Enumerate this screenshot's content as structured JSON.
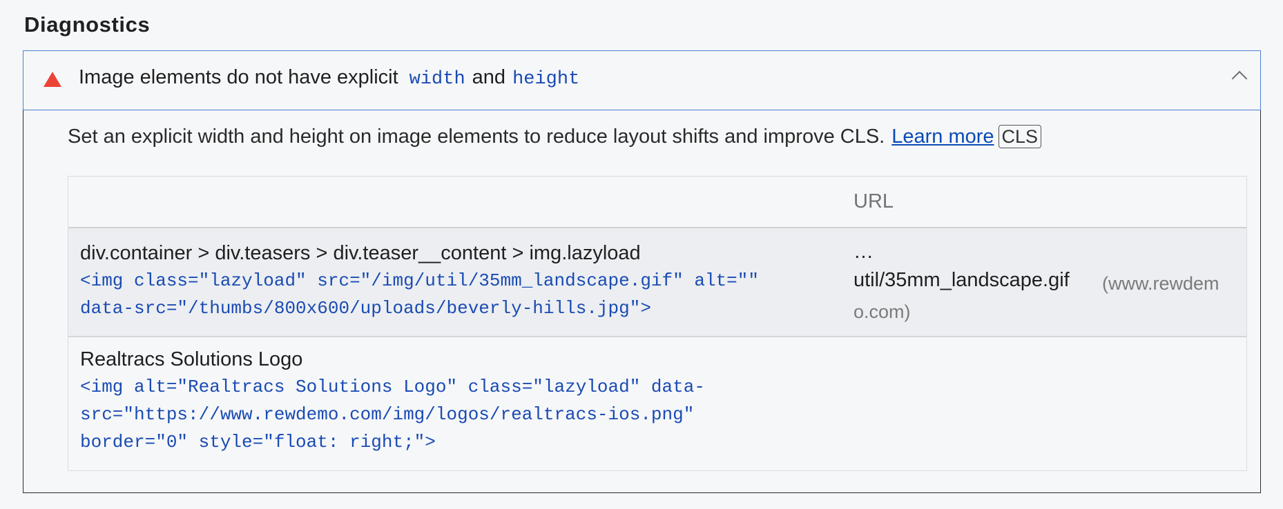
{
  "section": {
    "title": "Diagnostics"
  },
  "audit": {
    "icon": "fail-triangle-icon",
    "title_prefix": "Image elements do not have explicit",
    "title_code_1": "width",
    "title_and": "and",
    "title_code_2": "height",
    "description": "Set an explicit width and height on image elements to reduce layout shifts and improve CLS.",
    "learn_more": "Learn more",
    "badge": "CLS",
    "colors": {
      "fail": "#eb4335",
      "code": "#1a4bb3",
      "link": "#0b4bb6",
      "border_active": "#4a7fd4"
    }
  },
  "table": {
    "headers": [
      "",
      "URL"
    ],
    "rows": [
      {
        "node": "div.container > div.teasers > div.teaser__content > img.lazyload",
        "snippet_line1": "<img class=\"lazyload\" src=\"/img/util/35mm_landscape.gif\" alt=\"\"",
        "snippet_line2": "data-src=\"/thumbs/800x600/uploads/beverly-hills.jpg\">",
        "url_ellipsis": "…",
        "url_path": "util/35mm_landscape.gif",
        "url_host_line1": "(www.rewdem",
        "url_host_line2": "o.com)"
      },
      {
        "node": "Realtracs Solutions Logo",
        "snippet_line1": "<img alt=\"Realtracs Solutions Logo\" class=\"lazyload\" data-",
        "snippet_line2": "src=\"https://www.rewdemo.com/img/logos/realtracs-ios.png\"",
        "snippet_line3": "border=\"0\" style=\"float: right;\">"
      }
    ]
  }
}
